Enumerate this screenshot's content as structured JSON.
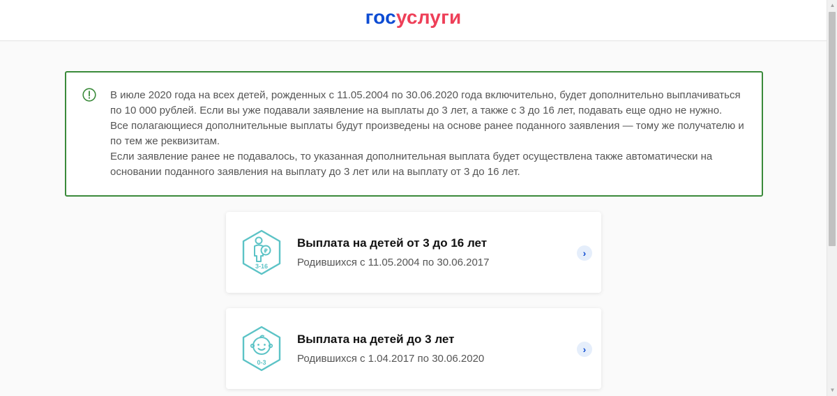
{
  "header": {
    "logo_part1": "гос",
    "logo_part2": "услуги"
  },
  "notice": {
    "icon": "exclamation-circle-icon",
    "paragraphs": [
      "В июле 2020 года на всех детей, рожденных с 11.05.2004 по 30.06.2020 года включительно, будет дополнительно выплачиваться по 10 000 рублей. Если вы уже подавали заявление на выплаты до 3 лет, а также с 3 до 16 лет, подавать еще одно не нужно.",
      "Все полагающиеся дополнительные выплаты будут произведены на основе ранее поданного заявления — тому же получателю и по тем же реквизитам.",
      "Если заявление ранее не подавалось, то указанная дополнительная выплата будет осуществлена также автоматически на основании поданного заявления на выплату до 3 лет или на выплату от 3 до 16 лет."
    ]
  },
  "cards": [
    {
      "title": "Выплата на детей от 3 до 16 лет",
      "subtitle": "Родившихся с 11.05.2004 по 30.06.2017",
      "badge": "3-16",
      "icon": "child-ruble-icon",
      "arrow": "›"
    },
    {
      "title": "Выплата на детей до 3 лет",
      "subtitle": "Родившихся с 1.04.2017 по 30.06.2020",
      "badge": "0-3",
      "icon": "baby-face-icon",
      "arrow": "›"
    }
  ],
  "colors": {
    "logo_blue": "#0d4cd3",
    "logo_red": "#ee3f58",
    "notice_border": "#3a8a3a",
    "icon_teal": "#5cc3c6"
  }
}
